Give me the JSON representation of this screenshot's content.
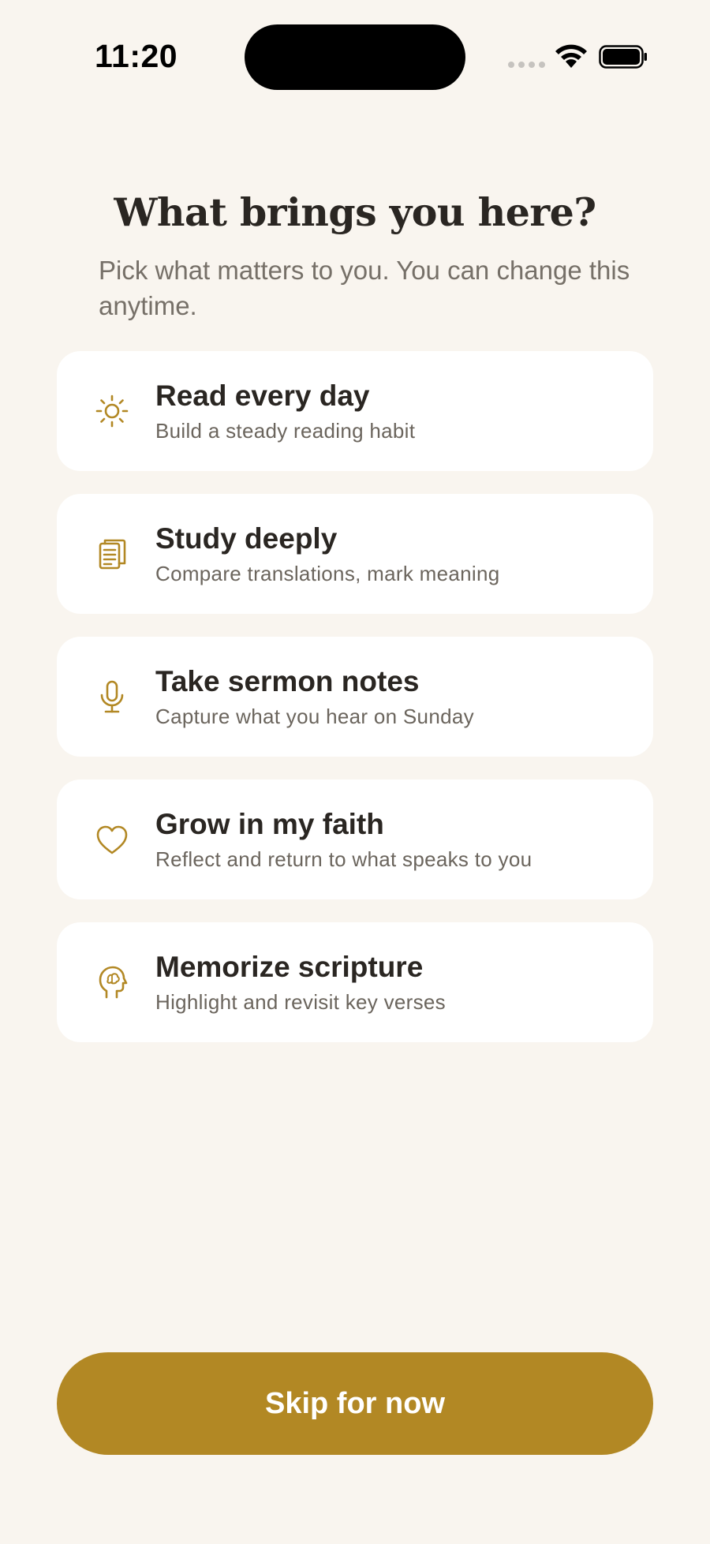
{
  "status_bar": {
    "time": "11:20"
  },
  "header": {
    "title": "What brings you here?",
    "subtitle": "Pick what matters to you. You can change this anytime."
  },
  "options": [
    {
      "label": "Read every day",
      "description": "Build a steady reading habit",
      "icon": "sun-icon"
    },
    {
      "label": "Study deeply",
      "description": "Compare translations, mark meaning",
      "icon": "document-icon"
    },
    {
      "label": "Take sermon notes",
      "description": "Capture what you hear on Sunday",
      "icon": "microphone-icon"
    },
    {
      "label": "Grow in my faith",
      "description": "Reflect and return to what speaks to you",
      "icon": "heart-icon"
    },
    {
      "label": "Memorize scripture",
      "description": "Highlight and revisit key verses",
      "icon": "brain-head-icon"
    }
  ],
  "footer": {
    "skip_label": "Skip for now"
  },
  "colors": {
    "background": "#f9f5ef",
    "accent": "#b28824",
    "card": "#ffffff",
    "text_primary": "#2a2622",
    "text_secondary": "#6b655d"
  }
}
